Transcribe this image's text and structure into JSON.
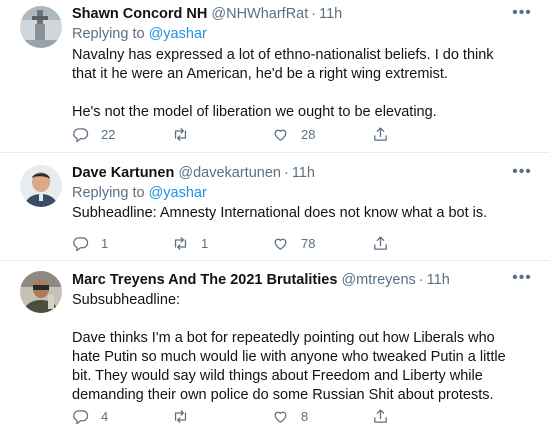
{
  "tweets": [
    {
      "name": "Shawn Concord NH",
      "handle": "@NHWharfRat",
      "separator": "·",
      "time": "11h",
      "replying_prefix": "Replying to",
      "replying_to": "@yashar",
      "paragraphs": [
        "Navalny has expressed a lot of ethno-nationalist beliefs. I do think that it he were an American, he'd be a right wing extremist.",
        "He's not the model of liberation we ought to be elevating."
      ],
      "replies": "22",
      "retweets": "",
      "likes": "28",
      "more_icon": "ellipsis-icon"
    },
    {
      "name": "Dave Kartunen",
      "handle": "@davekartunen",
      "separator": "·",
      "time": "11h",
      "replying_prefix": "Replying to",
      "replying_to": "@yashar",
      "paragraphs": [
        "Subheadline: Amnesty International does not know what a bot is."
      ],
      "replies": "1",
      "retweets": "1",
      "likes": "78",
      "more_icon": "ellipsis-icon"
    },
    {
      "name": "Marc Treyens And The 2021 Brutalities",
      "handle": "@mtreyens",
      "separator": "·",
      "time": "11h",
      "paragraphs": [
        "Subsubheadline:",
        "Dave thinks I'm a bot for repeatedly pointing out how Liberals who hate Putin so much would lie with anyone who tweaked Putin a little bit. They would say wild things about Freedom and Liberty while demanding their own police do some Russian Shit about protests."
      ],
      "replies": "4",
      "retweets": "",
      "likes": "8",
      "more_icon": "ellipsis-icon"
    }
  ],
  "colors": {
    "text": "#0f1419",
    "secondary": "#5b7083",
    "link": "#1b95e0",
    "divider": "#e6ecf0"
  },
  "icons": {
    "reply": "reply-icon",
    "retweet": "retweet-icon",
    "like": "like-icon",
    "share": "share-icon"
  }
}
